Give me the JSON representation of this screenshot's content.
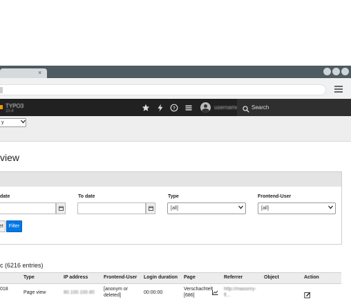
{
  "browser": {
    "tab_close_glyph": "×",
    "url_fragment": "|"
  },
  "topbar": {
    "site_name": "TYPO3",
    "site_version": "10.4",
    "username": "username",
    "search_label": "Search",
    "icons": [
      "star-icon",
      "lightning-icon",
      "help-icon",
      "list-icon",
      "user-icon"
    ]
  },
  "docheader": {
    "menu_value": "y"
  },
  "page": {
    "title": "view"
  },
  "filter": {
    "from_label": "date",
    "to_label": "To date",
    "type_label": "Type",
    "user_label": "Frontend-User",
    "type_value": "[all]",
    "user_value": "[all]",
    "reset_label": "et",
    "filter_label": "Filter"
  },
  "results": {
    "title": "c (6216 entries)",
    "columns": [
      "Type",
      "IP address",
      "Frontend-User",
      "Login duration",
      "Page",
      "Referrer",
      "Object",
      "Action"
    ],
    "rows": [
      {
        "date": "018",
        "type": "Page view",
        "ip": "80.100.100.80",
        "user": "[anonym or deleted]",
        "duration": "00:00:00",
        "page": "Verschachtelt [686]",
        "referrer": "http://masonry-fl...",
        "object": ""
      }
    ]
  }
}
